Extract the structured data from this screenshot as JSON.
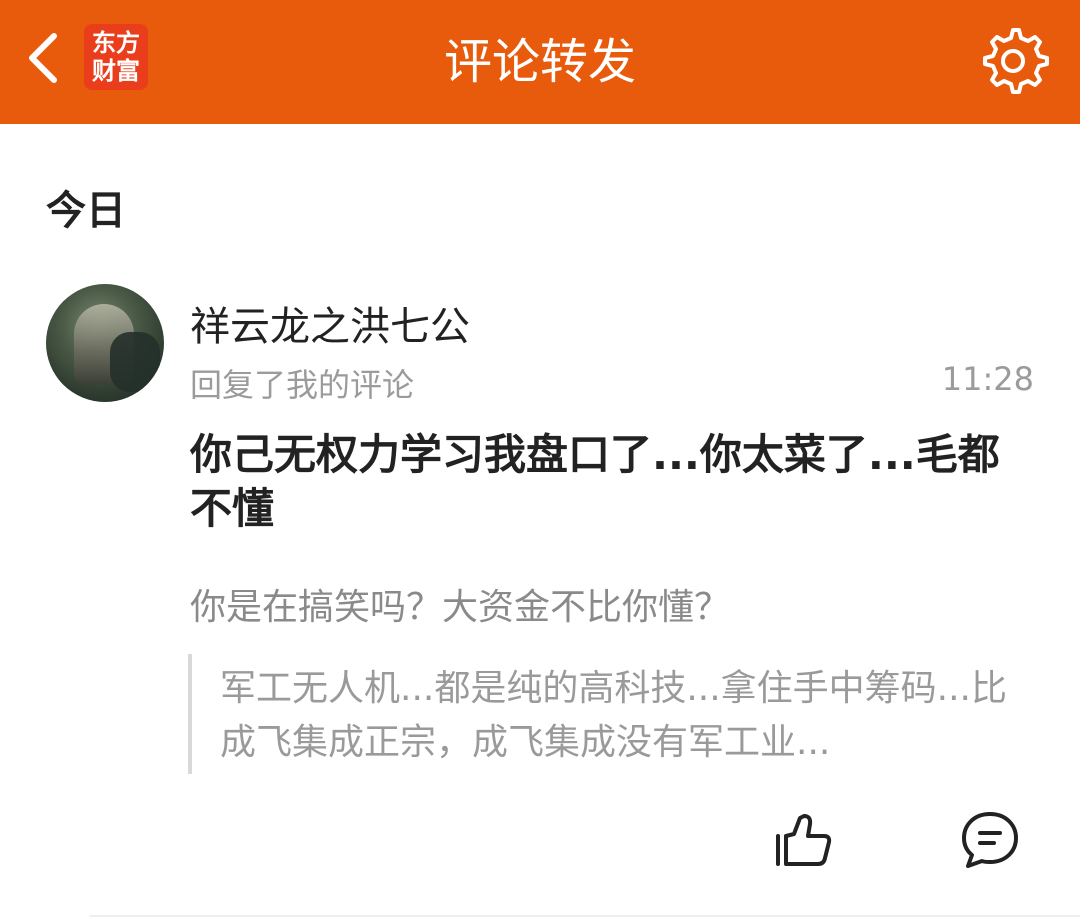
{
  "header": {
    "logo_line1": "东方",
    "logo_line2": "财富",
    "title": "评论转发",
    "icons": {
      "back": "chevron-left-icon",
      "settings": "gear-icon"
    }
  },
  "section": {
    "date_label": "今日"
  },
  "notification": {
    "user_name": "祥云龙之洪七公",
    "action": "回复了我的评论",
    "time": "11:28",
    "reply_text": "你己无权力学习我盘口了...你太菜了...毛都不懂",
    "my_comment": "你是在搞笑吗？大资金不比你懂？",
    "quoted_text": "军工无人机...都是纯的高科技...拿住手中筹码...比成飞集成正宗，成飞集成没有军工业...",
    "actions": {
      "like_icon": "thumbs-up-icon",
      "reply_icon": "comment-bubble-icon"
    }
  },
  "colors": {
    "header_bg": "#e85a0c",
    "logo_bg": "#ea3d1c",
    "muted_text": "#9b9b9b"
  }
}
